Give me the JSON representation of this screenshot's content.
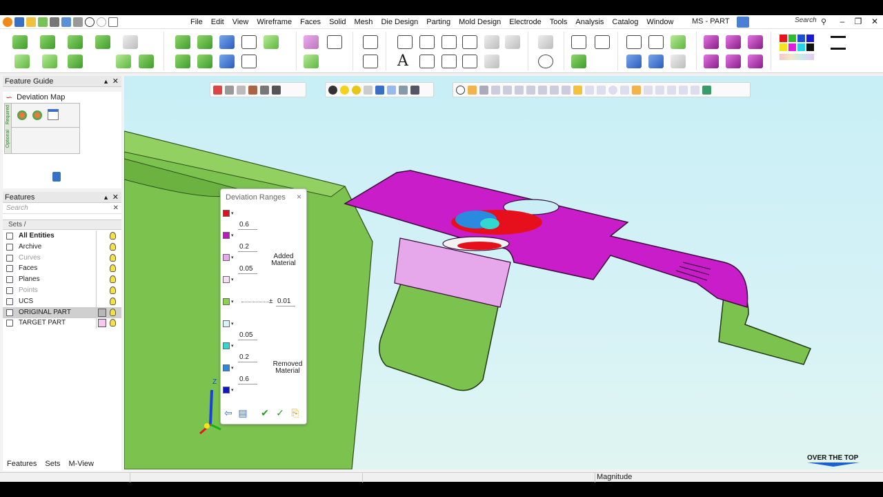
{
  "window": {
    "title": "MS - PART",
    "search_placeholder": "Search",
    "controls": [
      "–",
      "❐",
      "✕"
    ]
  },
  "menu": [
    "File",
    "Edit",
    "View",
    "Wireframe",
    "Faces",
    "Solid",
    "Mesh",
    "Die Design",
    "Parting",
    "Mold Design",
    "Electrode",
    "Tools",
    "Analysis",
    "Catalog",
    "Window"
  ],
  "feature_guide": {
    "title": "Feature Guide",
    "item": "Deviation Map",
    "tab_required": "Required",
    "tab_optional": "Optional"
  },
  "features": {
    "title": "Features",
    "search_placeholder": "Search",
    "sets_header": "Sets",
    "rows": [
      {
        "label": "All Entities",
        "bold": true,
        "dim": false
      },
      {
        "label": "Archive",
        "bold": false,
        "dim": false
      },
      {
        "label": "Curves",
        "bold": false,
        "dim": true
      },
      {
        "label": "Faces",
        "bold": false,
        "dim": false
      },
      {
        "label": "Planes",
        "bold": false,
        "dim": false
      },
      {
        "label": "Points",
        "bold": false,
        "dim": true
      },
      {
        "label": "UCS",
        "bold": false,
        "dim": false
      },
      {
        "label": "ORIGINAL PART",
        "bold": false,
        "dim": false,
        "selected": true,
        "color": "#b7b7b7"
      },
      {
        "label": "TARGET PART",
        "bold": false,
        "dim": false,
        "color": "#f8c8f0"
      }
    ]
  },
  "bottom_tabs": [
    "Features",
    "Sets",
    "M-View"
  ],
  "deviation_dialog": {
    "title": "Deviation Ranges",
    "close": "×",
    "added_label": "Added Material",
    "removed_label": "Removed Material",
    "tolerance_prefix": "±",
    "tolerance": "0.01",
    "added_values": [
      "0.6",
      "0.2",
      "0.05"
    ],
    "removed_values": [
      "0.05",
      "0.2",
      "0.6"
    ],
    "colors": {
      "added": [
        "#e0101c",
        "#c018c0",
        "#e8a8f0",
        "#f8e0f4"
      ],
      "zero": "#8dd14a",
      "removed": [
        "#d8f4f6",
        "#30d8d0",
        "#2a8ae0",
        "#1016c8"
      ]
    }
  },
  "viewport": {
    "axis_label": "Z",
    "brand": "OVER THE TOP"
  },
  "status": {
    "mode": "Magnitude"
  }
}
